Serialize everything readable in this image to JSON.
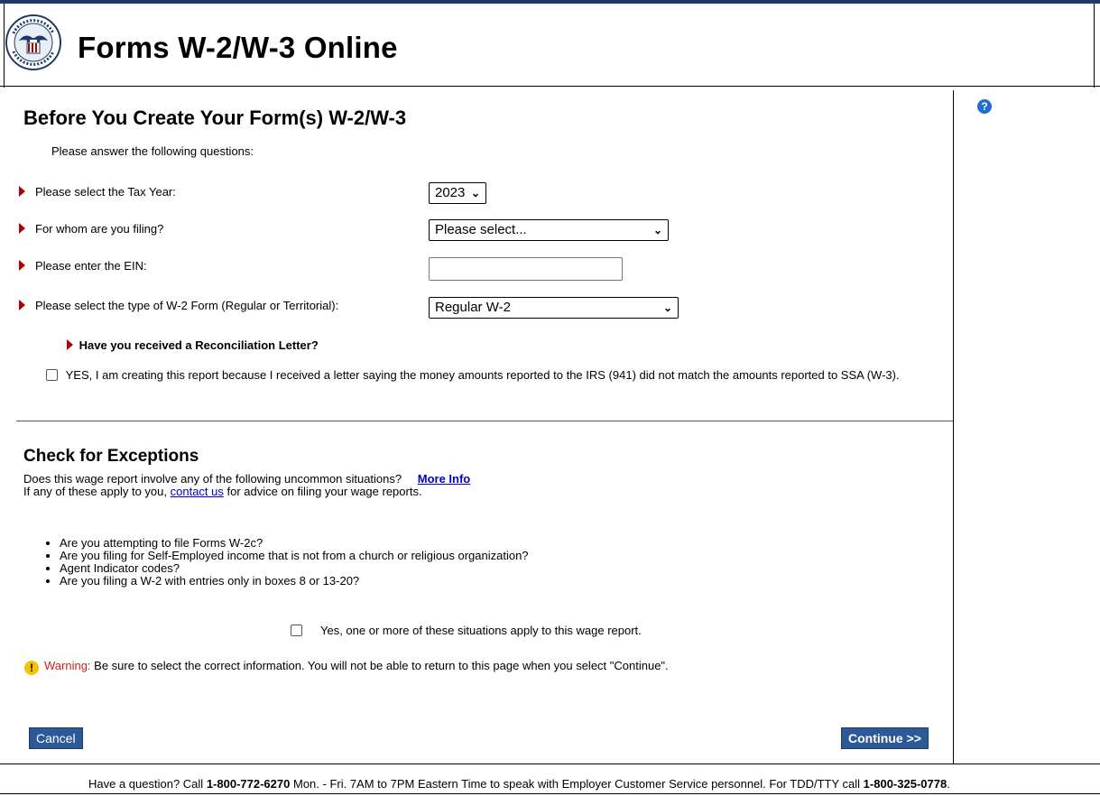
{
  "header": {
    "title": "Forms W-2/W-3 Online",
    "logo_icon": "ssa-seal-icon"
  },
  "page": {
    "title": "Before You Create Your Form(s) W-2/W-3",
    "intro": "Please answer the following questions:"
  },
  "questions": {
    "tax_year": {
      "label": "Please select the Tax Year:",
      "value": "2023"
    },
    "filing_for": {
      "label": "For whom are you filing?",
      "value": "Please select..."
    },
    "ein": {
      "label": "Please enter the EIN:",
      "value": ""
    },
    "w2_type": {
      "label": "Please select the type of W-2 Form (Regular or Territorial):",
      "value": "Regular W-2"
    }
  },
  "reconciliation": {
    "question": "Have you received a Reconciliation Letter?",
    "yes_text": "YES, I am creating this report because I received a letter saying the money amounts reported to the IRS (941) did not match the amounts reported to SSA (W-3)."
  },
  "exceptions": {
    "title": "Check for Exceptions",
    "line1": "Does this wage report involve any of the following uncommon situations?",
    "more_info": "More Info",
    "line2_pre": "If any of these apply to you,",
    "contact_link": "contact us",
    "line2_post": "for advice on filing your wage reports.",
    "items": [
      "Are you attempting to file Forms W-2c?",
      "Are you filing for Self-Employed income that is not from a church or religious organization?",
      "Agent Indicator codes?",
      "Are you filing a W-2 with entries only in boxes 8 or 13-20?"
    ],
    "apply_text": "Yes, one or more of these situations apply to this wage report."
  },
  "warning": {
    "label": "Warning:",
    "text": "Be sure to select the correct information. You will not be able to return to this page when you select \"Continue\"."
  },
  "buttons": {
    "cancel": "Cancel",
    "continue": "Continue >>"
  },
  "footer": {
    "pre": "Have a question? Call",
    "phone1": "1-800-772-6270",
    "mid": "Mon. - Fri. 7AM to 7PM Eastern Time to speak with Employer Customer Service personnel. For TDD/TTY call",
    "phone2": "1-800-325-0778",
    "end": "."
  },
  "colors": {
    "button_bg": "#2d5a96",
    "arrow": "#b00000",
    "warning_label": "#d01c1c",
    "link": "#0000cc",
    "help_icon": "#1f6fcf"
  }
}
